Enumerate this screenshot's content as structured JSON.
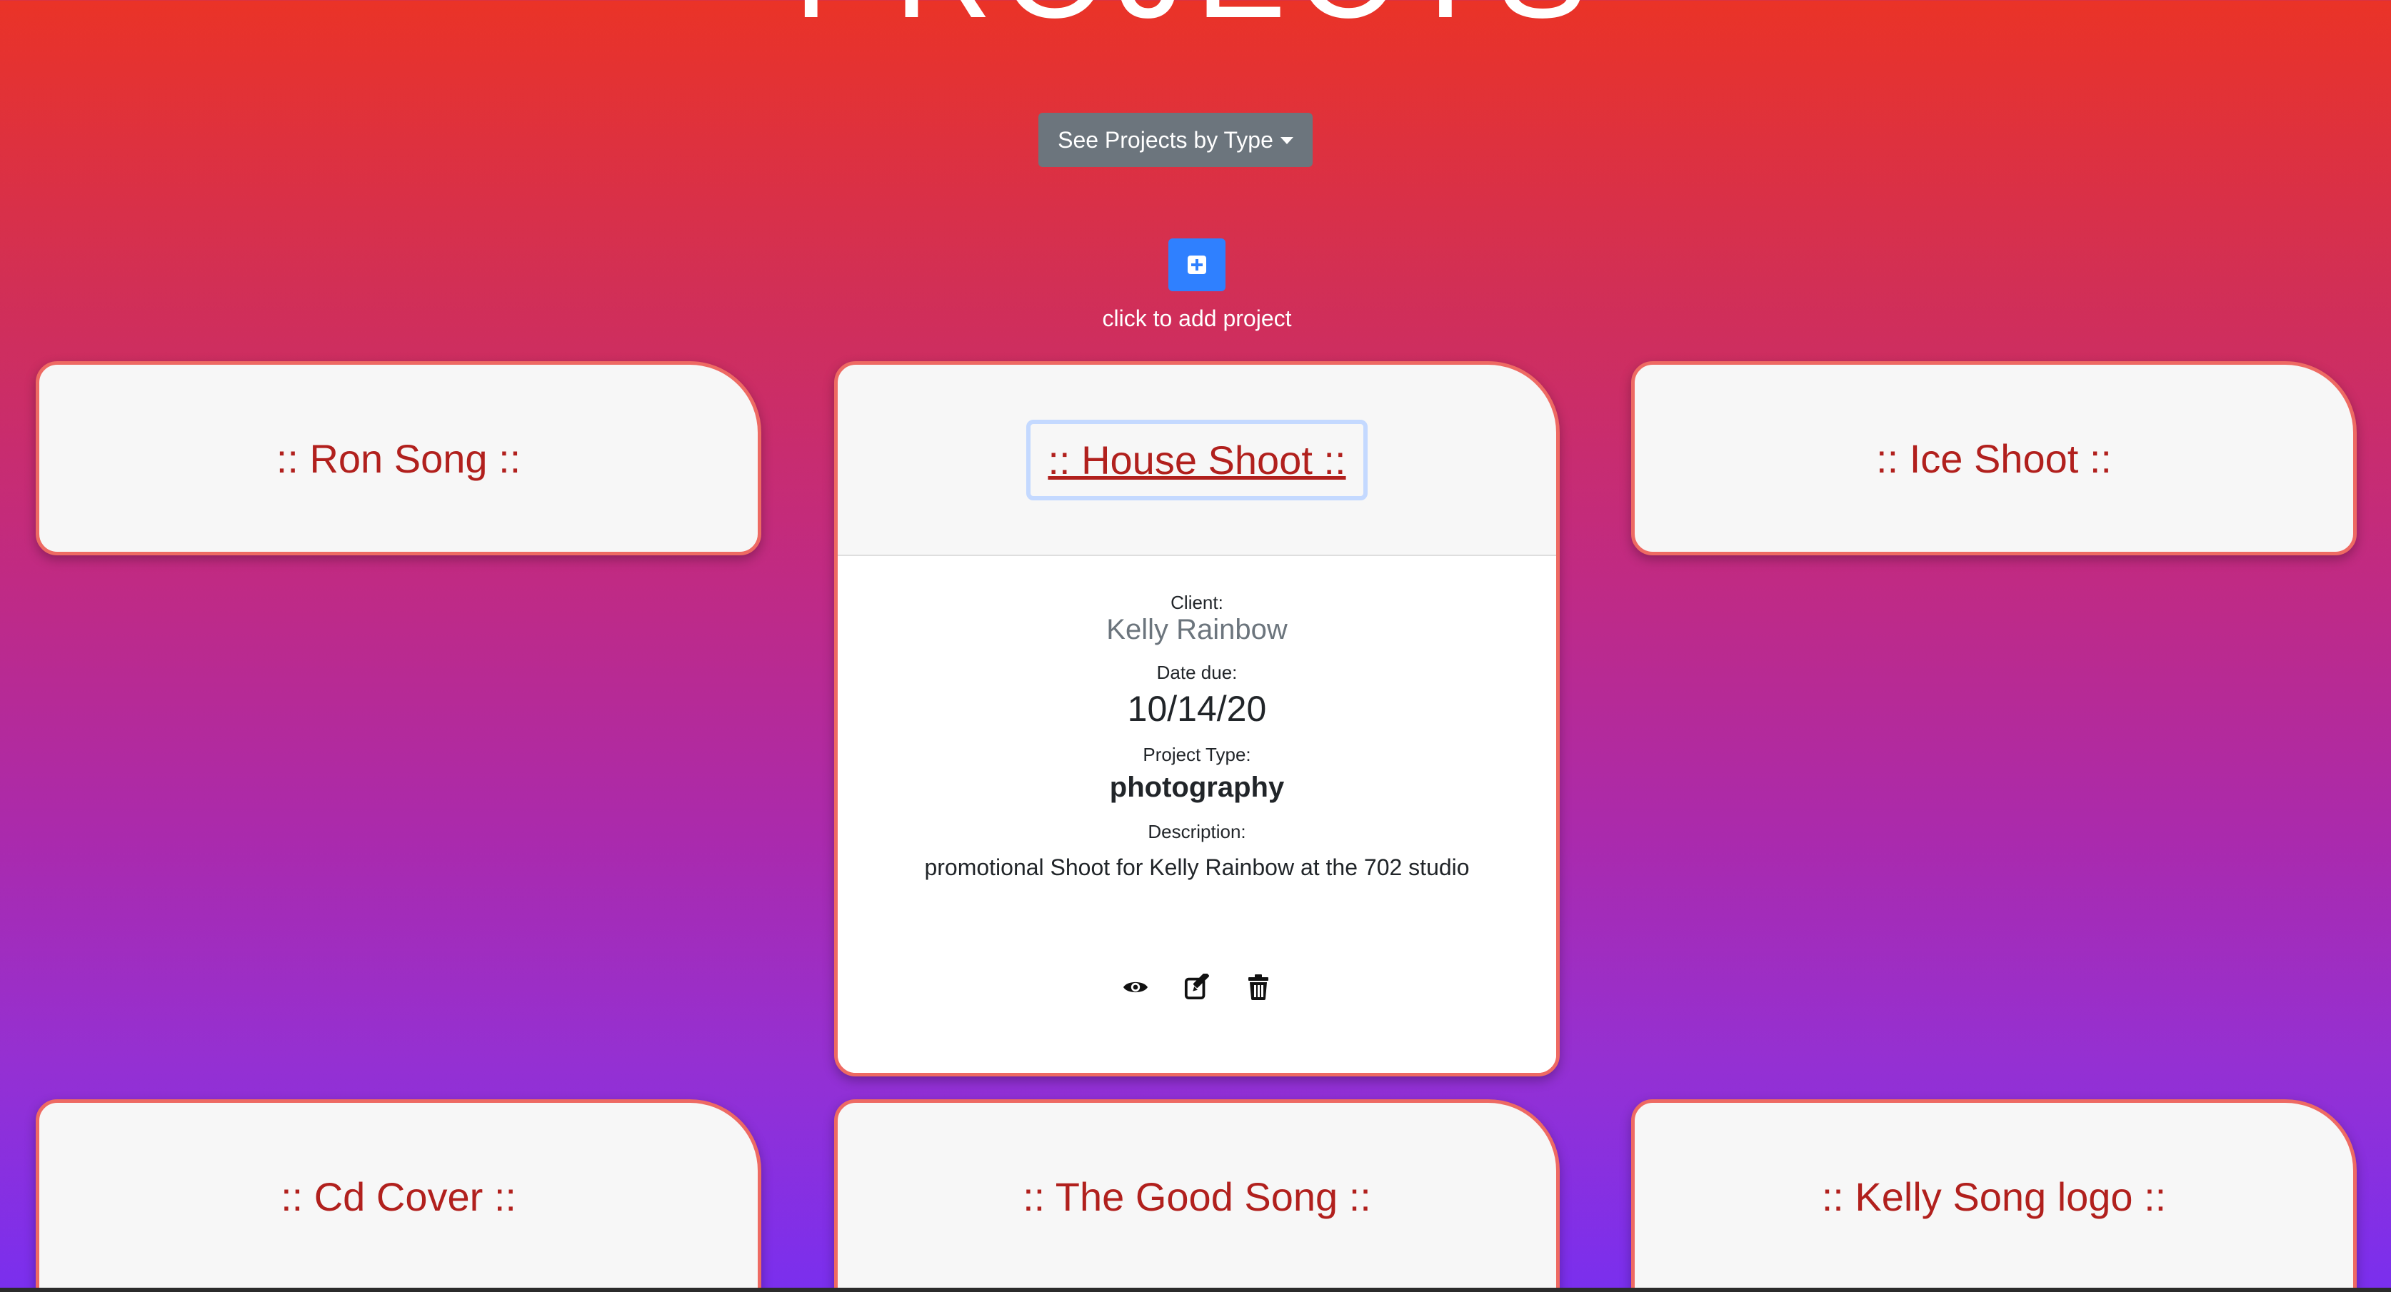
{
  "page": {
    "title": "PROJECTS"
  },
  "controls": {
    "dropdown_label": "See Projects by Type",
    "add_label": "click to add project"
  },
  "field_labels": {
    "client": "Client:",
    "date_due": "Date due:",
    "project_type": "Project Type:",
    "description": "Description:"
  },
  "projects": [
    {
      "title": ":: Ron Song ::"
    },
    {
      "title": ":: House Shoot ::",
      "client": "Kelly Rainbow",
      "date_due": "10/14/20",
      "project_type": "photography",
      "description": "promotional Shoot for Kelly Rainbow at the 702 studio"
    },
    {
      "title": ":: Ice Shoot ::"
    },
    {
      "title": ":: Cd Cover ::"
    },
    {
      "title": ":: The Good Song ::"
    },
    {
      "title": ":: Kelly Song logo ::"
    }
  ],
  "icons": {
    "add": "plus-square-icon",
    "view": "eye-icon",
    "edit": "edit-icon",
    "delete": "trash-icon",
    "dropdown": "caret-down-icon"
  },
  "colors": {
    "title_text": "#b1201d",
    "card_border": "#ee6a63",
    "add_button": "#2f80ff",
    "dropdown_button": "#6c757d"
  }
}
